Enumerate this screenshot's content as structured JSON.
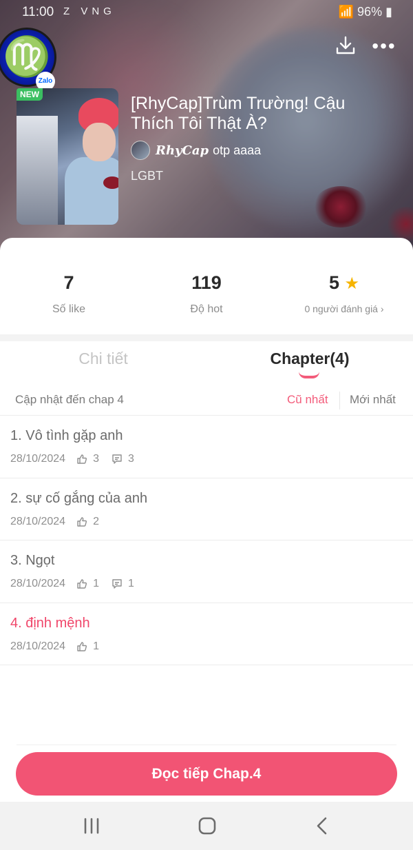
{
  "status_bar": {
    "time": "11:00",
    "left_icons": "Z VNG",
    "battery": "96%"
  },
  "story": {
    "badge": "NEW",
    "title": "[RhyCap]Trùm Trường! Cậu Thích Tôi Thật À?",
    "author": "RhyCap",
    "author_suffix": "otp aaaa",
    "tag": "LGBT",
    "zalo_label": "Zalo"
  },
  "stats": [
    {
      "value": "7",
      "label": "Số like"
    },
    {
      "value": "119",
      "label": "Độ hot"
    },
    {
      "value": "5",
      "label": "0 người đánh giá",
      "suffix": "›"
    }
  ],
  "tabs": [
    {
      "label": "Chi tiết",
      "active": false
    },
    {
      "label": "Chapter(4)",
      "active": true
    }
  ],
  "sort": {
    "update_text": "Cập nhật đến chap 4",
    "oldest": "Cũ nhất",
    "newest": "Mới nhất"
  },
  "chapters": [
    {
      "title": "1. Vô tình gặp anh",
      "date": "28/10/2024",
      "likes": "3",
      "comments": "3"
    },
    {
      "title": "2. sự cố gắng của anh",
      "date": "28/10/2024",
      "likes": "2",
      "comments": ""
    },
    {
      "title": "3. Ngọt",
      "date": "28/10/2024",
      "likes": "1",
      "comments": "1"
    },
    {
      "title": "4. định mệnh",
      "date": "28/10/2024",
      "likes": "1",
      "comments": "",
      "active": true
    }
  ],
  "cta": {
    "label": "Đọc tiếp Chap.4"
  },
  "colors": {
    "accent": "#f25474",
    "star": "#f6b400",
    "new_badge": "#3bbf61"
  }
}
